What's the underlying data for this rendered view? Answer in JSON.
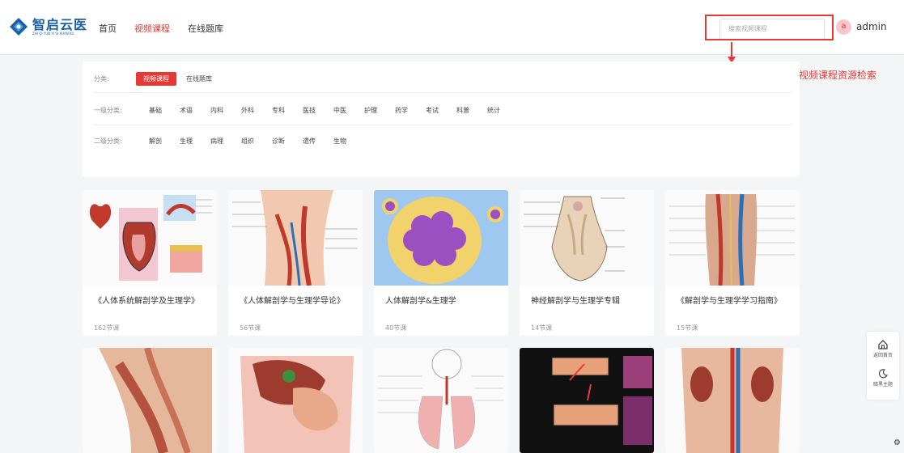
{
  "header": {
    "logo_title": "智启云医",
    "logo_sub": "ZHI QI YUN YI SI XUAN KU",
    "nav": [
      "首页",
      "视频课程",
      "在线题库"
    ],
    "nav_active": 1,
    "search_placeholder": "搜索视频课程",
    "avatar_letter": "a",
    "username": "admin"
  },
  "annotation": "在此输入关键字词进行视频课程资源检索",
  "filters": {
    "category_label": "分类:",
    "category_options": [
      "视频课程",
      "在线题库"
    ],
    "level1_label": "一级分类:",
    "level1_options": [
      "基础",
      "术语",
      "内科",
      "外科",
      "专科",
      "医技",
      "中医",
      "护理",
      "药学",
      "考试",
      "科普",
      "统计"
    ],
    "level2_label": "二级分类:",
    "level2_options": [
      "解剖",
      "生理",
      "病理",
      "组织",
      "诊断",
      "遗传",
      "生物"
    ]
  },
  "courses": [
    {
      "title": "《人体系统解剖学及生理学》",
      "count": "162节课"
    },
    {
      "title": "《人体解剖学与生理学导论》",
      "count": "56节课"
    },
    {
      "title": "人体解剖学&生理学",
      "count": "40节课"
    },
    {
      "title": "神经解剖学与生理学专辑",
      "count": "14节课"
    },
    {
      "title": "《解剖学与生理学学习指南》",
      "count": "15节课"
    }
  ],
  "side_tools": {
    "home_label": "返回首页",
    "theme_label": "暗黑主题"
  },
  "colors": {
    "accent": "#e53935",
    "brand": "#1b5fa8"
  }
}
